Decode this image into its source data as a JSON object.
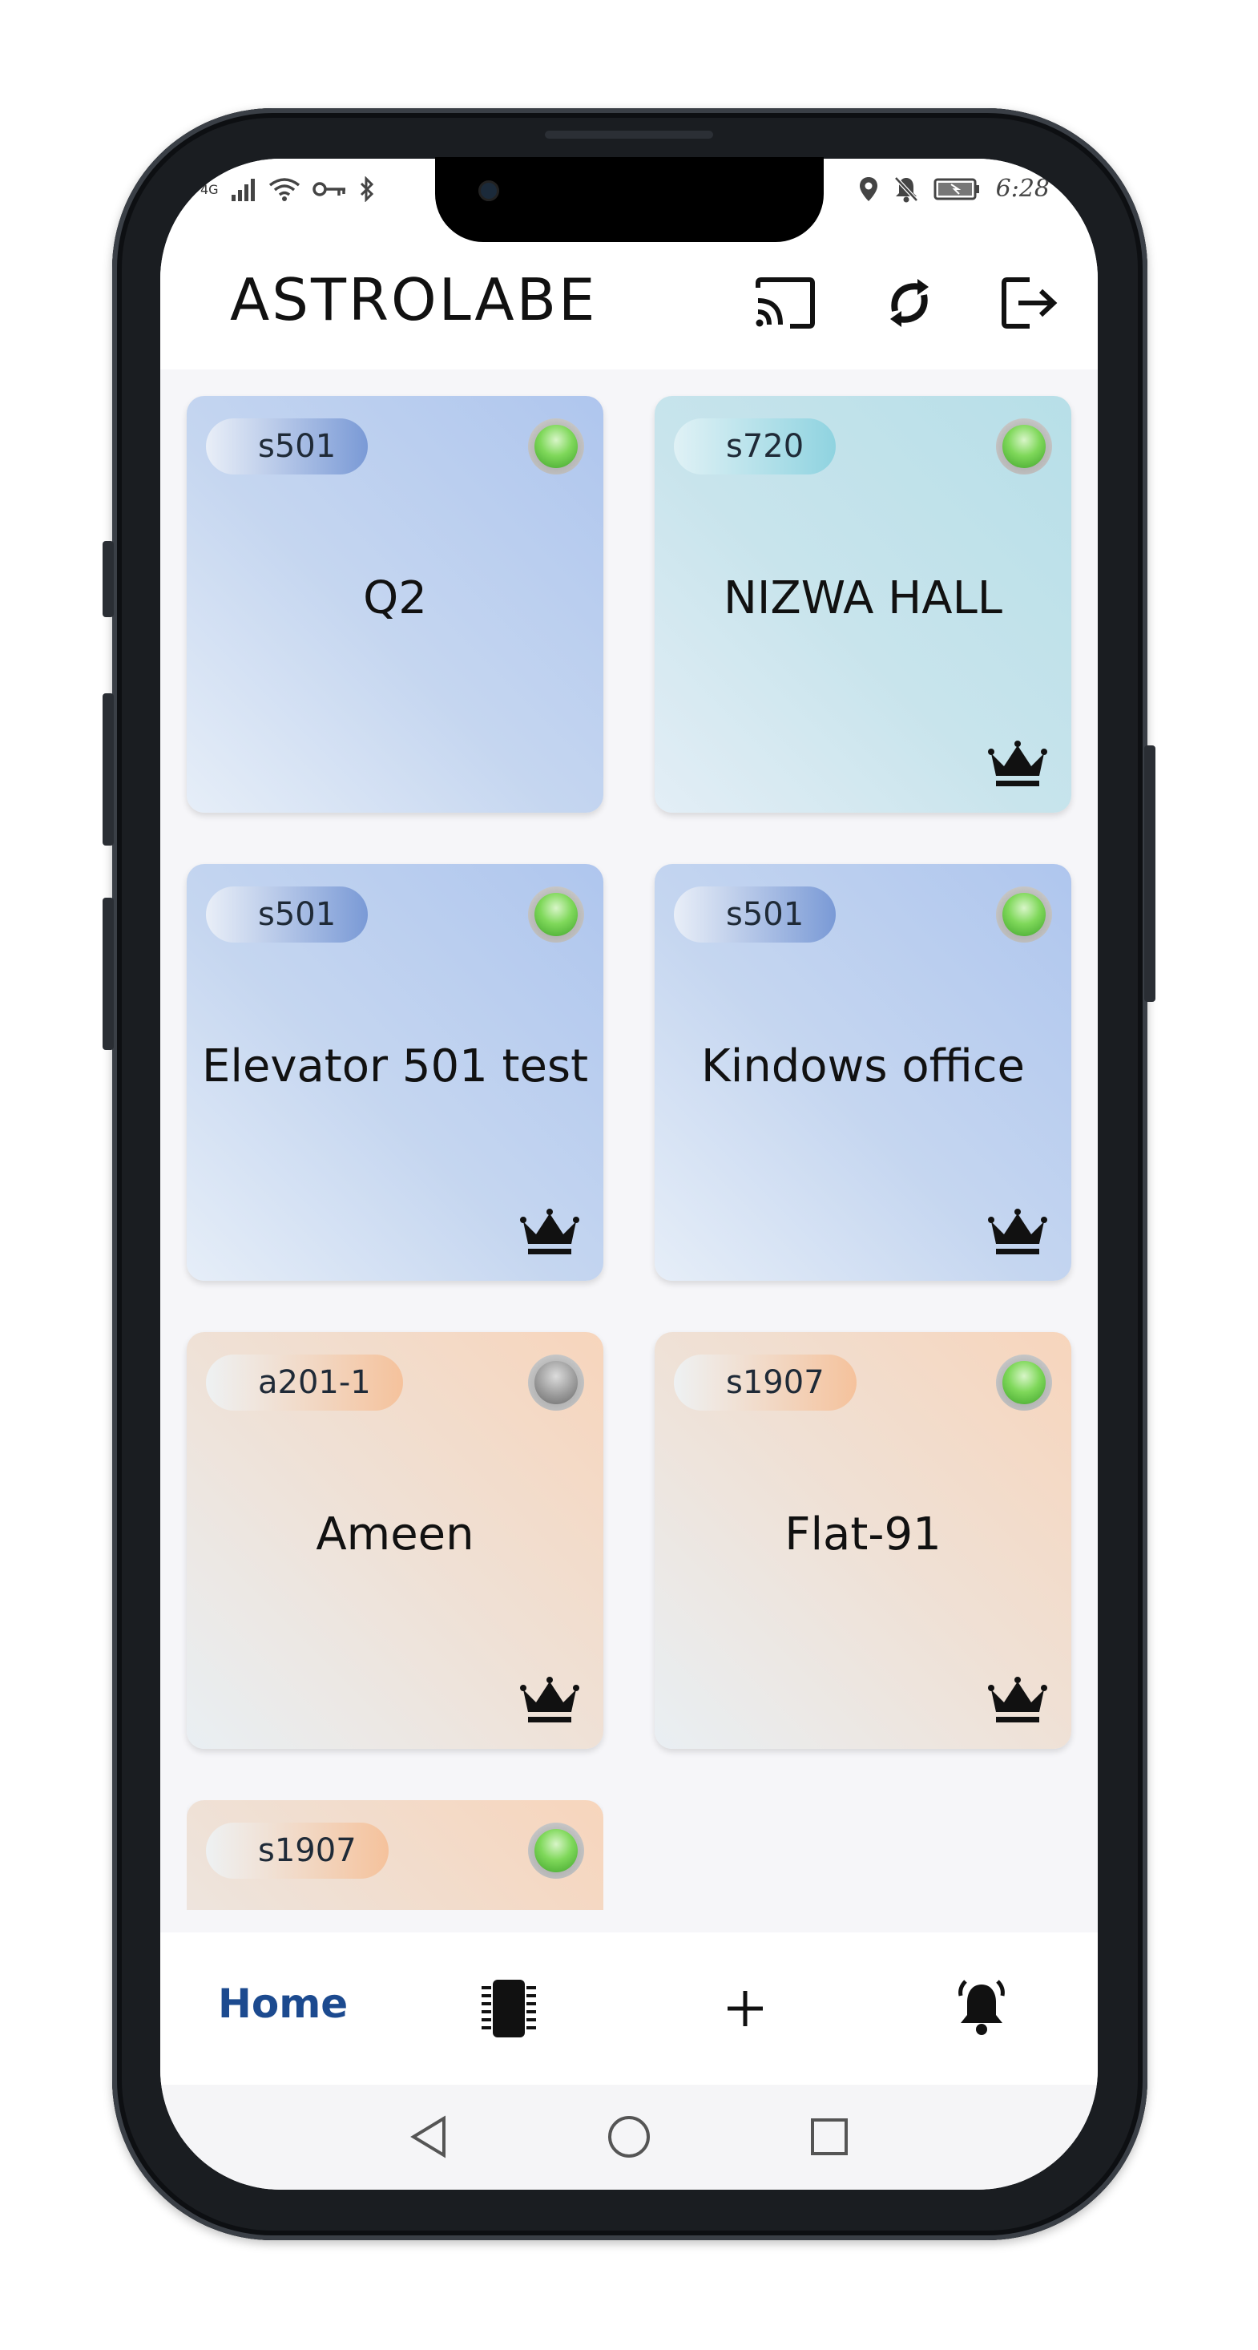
{
  "status_bar": {
    "network": "4G",
    "time": "6:28"
  },
  "app_bar": {
    "title": "ASTROLABE",
    "icons": [
      "cast-icon",
      "sync-icon",
      "logout-icon"
    ]
  },
  "devices": [
    {
      "model": "s501",
      "name": "Q2",
      "online": true,
      "owner": false,
      "theme": "blue"
    },
    {
      "model": "s720",
      "name": "NIZWA HALL",
      "online": true,
      "owner": true,
      "theme": "teal"
    },
    {
      "model": "s501",
      "name": "Elevator 501 test",
      "online": true,
      "owner": true,
      "theme": "blue"
    },
    {
      "model": "s501",
      "name": "Kindows office",
      "online": true,
      "owner": true,
      "theme": "blue"
    },
    {
      "model": "a201-1",
      "name": "Ameen",
      "online": false,
      "owner": true,
      "theme": "peach"
    },
    {
      "model": "s1907",
      "name": "Flat-91",
      "online": true,
      "owner": true,
      "theme": "peach"
    },
    {
      "model": "s1907",
      "name": "",
      "online": true,
      "owner": false,
      "theme": "peach"
    }
  ],
  "bottom_nav": {
    "home_label": "Home",
    "icons": [
      "chip-icon",
      "plus-icon",
      "bell-icon"
    ]
  },
  "colors": {
    "accent": "#1c4a8f",
    "online_led": "#5cc23c",
    "offline_led": "#9a9a9a"
  }
}
